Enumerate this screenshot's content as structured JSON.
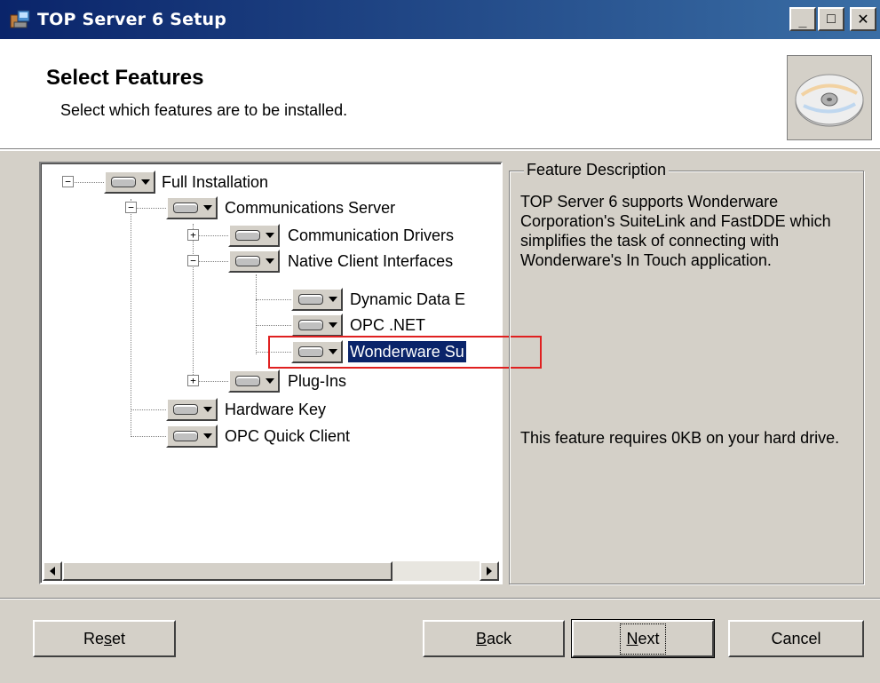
{
  "window": {
    "title": "TOP Server 6 Setup",
    "minimize": "_",
    "maximize": "□",
    "close": "✕"
  },
  "header": {
    "title": "Select Features",
    "subtitle": "Select which features are to be installed."
  },
  "tree": {
    "items": [
      {
        "label": "Full Installation",
        "expander": "−",
        "level": 0
      },
      {
        "label": "Communications Server",
        "expander": "−",
        "level": 1
      },
      {
        "label": "Communication Drivers",
        "expander": "+",
        "level": 2
      },
      {
        "label": "Native Client Interfaces",
        "expander": "−",
        "level": 2
      },
      {
        "label": "Dynamic Data E",
        "level": 3
      },
      {
        "label": "OPC .NET",
        "level": 3
      },
      {
        "label": "Wonderware Su",
        "level": 3,
        "selected": true
      },
      {
        "label": "Plug-Ins",
        "expander": "+",
        "level": 2
      },
      {
        "label": "Hardware Key",
        "level": 1
      },
      {
        "label": "OPC Quick Client",
        "level": 1
      }
    ]
  },
  "description": {
    "legend": "Feature Description",
    "text": "TOP Server 6 supports Wonderware Corporation's SuiteLink and FastDDE which simplifies the task of connecting with Wonderware's In Touch application.",
    "size_text": "This feature requires 0KB on your hard drive."
  },
  "buttons": {
    "reset": {
      "pre": "Re",
      "key": "s",
      "post": "et"
    },
    "back": {
      "pre": "",
      "key": "B",
      "post": "ack"
    },
    "next": {
      "pre": "",
      "key": "N",
      "post": "ext"
    },
    "cancel": "Cancel"
  },
  "colors": {
    "titlebar": "#0a246a",
    "selection": "#0a246a",
    "highlight_box": "#e02020",
    "dialog": "#d4d0c8"
  }
}
